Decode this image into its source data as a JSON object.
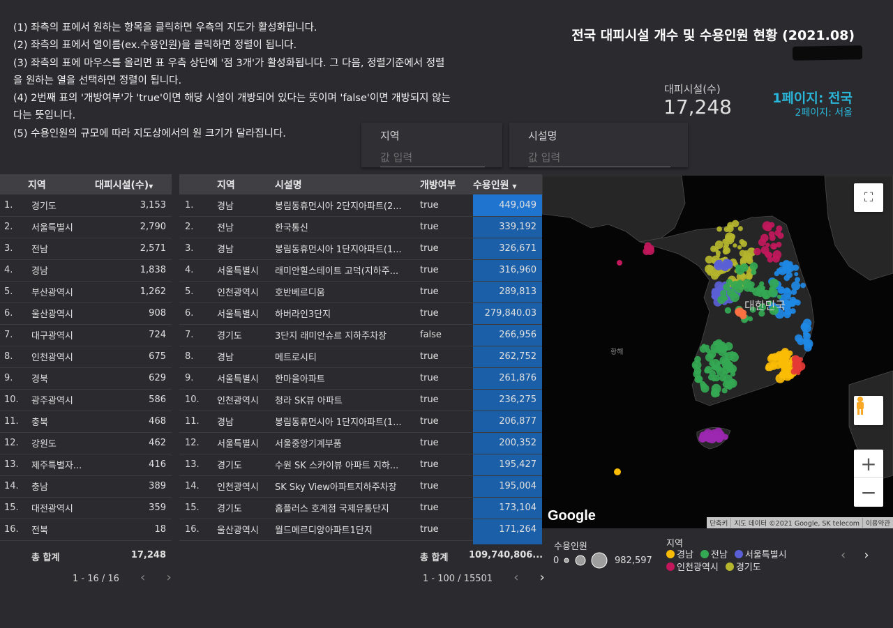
{
  "instructions": [
    "(1) 좌측의 표에서 원하는 항목을 클릭하면 우측의 지도가 활성화됩니다.",
    "(2) 좌측의 표에서 열이름(ex.수용인원)을 클릭하면 정렬이 됩니다.",
    "(3) 좌측의 표에 마우스를 올리면 표 우측 상단에 '점 3개'가 활성화됩니다. 그 다음, 정렬기준에서 정렬",
    "을 원하는 열을 선택하면 정렬이 됩니다.",
    "(4) 2번째 표의 '개방여부'가 'true'이면 해당 시설이 개방되어 있다는 뜻이며 'false'이면 개방되지 않는",
    "다는 뜻입니다.",
    "(5) 수용인원의 규모에 따라 지도상에서의 원 크기가 달라집니다."
  ],
  "title": "전국 대피시설 개수 및 수용인원 현황 (2021.08)",
  "scorecard": {
    "label": "대피시설(수)",
    "value": "17,248"
  },
  "pages": {
    "page1": "1페이지: 전국",
    "page2": "2페이지: 서울"
  },
  "filters": [
    {
      "label": "지역",
      "placeholder": "값 입력"
    },
    {
      "label": "시설명",
      "placeholder": "값 입력"
    }
  ],
  "table1": {
    "headers": [
      "지역",
      "대피시설(수)"
    ],
    "sort_icon": "sort-desc-icon",
    "rows": [
      [
        "1.",
        "경기도",
        "3,153"
      ],
      [
        "2.",
        "서울특별시",
        "2,790"
      ],
      [
        "3.",
        "전남",
        "2,571"
      ],
      [
        "4.",
        "경남",
        "1,838"
      ],
      [
        "5.",
        "부산광역시",
        "1,262"
      ],
      [
        "6.",
        "울산광역시",
        "908"
      ],
      [
        "7.",
        "대구광역시",
        "724"
      ],
      [
        "8.",
        "인천광역시",
        "675"
      ],
      [
        "9.",
        "경북",
        "629"
      ],
      [
        "10.",
        "광주광역시",
        "586"
      ],
      [
        "11.",
        "충북",
        "468"
      ],
      [
        "12.",
        "강원도",
        "462"
      ],
      [
        "13.",
        "제주특별자...",
        "416"
      ],
      [
        "14.",
        "충남",
        "389"
      ],
      [
        "15.",
        "대전광역시",
        "359"
      ],
      [
        "16.",
        "전북",
        "18"
      ]
    ],
    "total_label": "총 합계",
    "total_value": "17,248",
    "pager": "1 - 16 / 16"
  },
  "table2": {
    "headers": [
      "지역",
      "시설명",
      "개방여부",
      "수용인원"
    ],
    "rows": [
      [
        "1.",
        "경남",
        "봉림동휴먼시아 2단지아파트(2...",
        "true",
        "449,049"
      ],
      [
        "2.",
        "전남",
        "한국통신",
        "true",
        "339,192"
      ],
      [
        "3.",
        "경남",
        "봉림동휴먼시아 1단지아파트(1...",
        "true",
        "326,671"
      ],
      [
        "4.",
        "서울특별시",
        "래미안힐스테이트 고덕(지하주...",
        "true",
        "316,960"
      ],
      [
        "5.",
        "인천광역시",
        "호반베르디움",
        "true",
        "289,813"
      ],
      [
        "6.",
        "서울특별시",
        "하버라인3단지",
        "true",
        "279,840.03"
      ],
      [
        "7.",
        "경기도",
        "3단지 래미안슈르 지하주차장",
        "false",
        "266,956"
      ],
      [
        "8.",
        "경남",
        "메트로시티",
        "true",
        "262,752"
      ],
      [
        "9.",
        "서울특별시",
        "한마을아파트",
        "true",
        "261,876"
      ],
      [
        "10.",
        "인천광역시",
        "청라 SK뷰 아파트",
        "true",
        "236,275"
      ],
      [
        "11.",
        "경남",
        "봉림동휴먼시아 1단지아파트(1...",
        "true",
        "206,877"
      ],
      [
        "12.",
        "서울특별시",
        "서울중앙기계부품",
        "true",
        "200,352"
      ],
      [
        "13.",
        "경기도",
        "수원 SK 스카이뷰 아파트 지하...",
        "true",
        "195,427"
      ],
      [
        "14.",
        "인천광역시",
        "SK Sky View아파트지하주차장",
        "true",
        "195,004"
      ],
      [
        "15.",
        "경기도",
        "홈플러스 호계점 국제유통단지",
        "true",
        "173,104"
      ],
      [
        "16.",
        "울산광역시",
        "월드메르디앙아파트1단지",
        "true",
        "171,264"
      ]
    ],
    "total_label": "총 합계",
    "total_value": "109,740,806...",
    "pager": "1 - 100 / 15501"
  },
  "map": {
    "country_label": "대한민국",
    "sea_label": "황해",
    "google_logo": "Google",
    "attribution": [
      "단축키",
      "지도 데이터 ©2021 Google, SK telecom",
      "이용약관"
    ],
    "colors": {
      "gyeongnam": "#fbbc05",
      "jeonnam": "#34a853",
      "seoul": "#5b5fd6",
      "incheon": "#c2185b",
      "gyeonggi": "#b5b52e",
      "busan": "#e53935",
      "ulsan": "#1e88e5",
      "jeju": "#9c27b0",
      "daegu": "#ff7043"
    }
  },
  "legend": {
    "size_title": "수용인원",
    "size_min": "0",
    "size_max": "982,597",
    "region_title": "지역",
    "regions": [
      {
        "name": "경남",
        "color": "#fbbc05"
      },
      {
        "name": "전남",
        "color": "#34a853"
      },
      {
        "name": "서울특별시",
        "color": "#5b5fd6"
      },
      {
        "name": "인천광역시",
        "color": "#c2185b"
      },
      {
        "name": "경기도",
        "color": "#b5b52e"
      }
    ]
  }
}
